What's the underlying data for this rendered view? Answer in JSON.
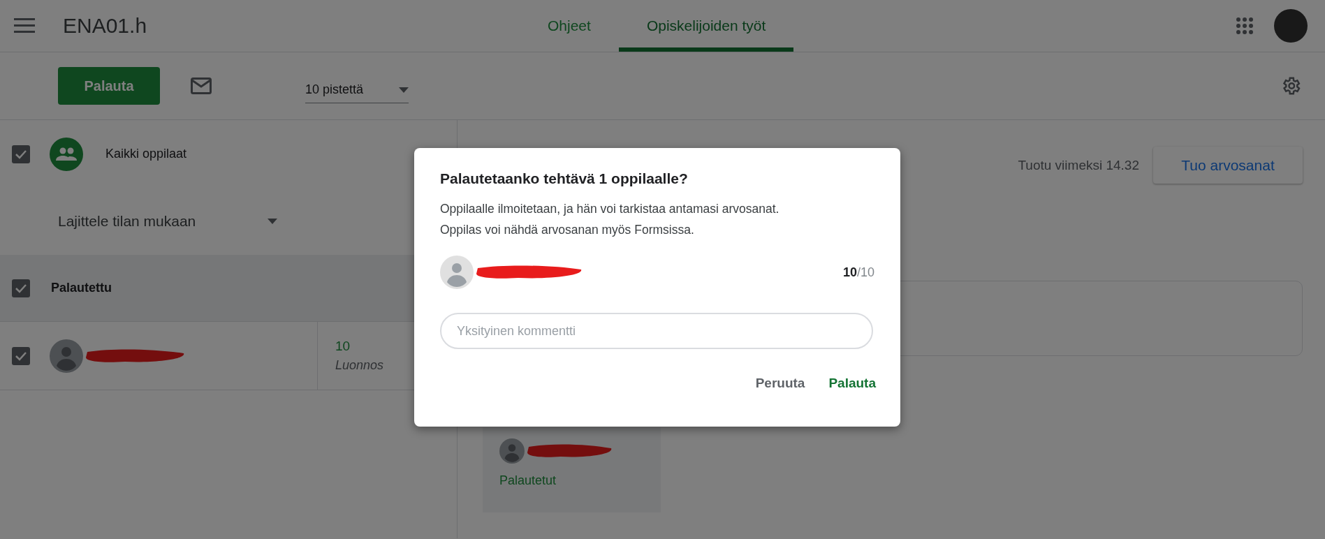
{
  "header": {
    "title": "ENA01.h",
    "tabs": [
      {
        "label": "Ohjeet",
        "selected": false
      },
      {
        "label": "Opiskelijoiden työt",
        "selected": true
      }
    ]
  },
  "toolbar": {
    "return_button": "Palauta",
    "points_dropdown": "10 pistettä"
  },
  "roster": {
    "all_students": {
      "label": "Kaikki oppilaat",
      "checked": true
    },
    "sort_dropdown": "Lajittele tilan mukaan",
    "groups": [
      {
        "label": "Palautettu",
        "checked": true,
        "students": [
          {
            "checked": true,
            "grade": "10",
            "status": "Luonnos"
          }
        ]
      }
    ]
  },
  "detail": {
    "last_imported": "Tuotu viimeksi 14.32",
    "import_button": "Tuo arvosanat",
    "card": {
      "status": "Palautetut"
    }
  },
  "dialog": {
    "title": "Palautetaanko tehtävä 1 oppilaalle?",
    "message": "Oppilaalle ilmoitetaan, ja hän voi tarkistaa antamasi arvosanat.\nOppilas voi nähdä arvosanan myös Formsissa.",
    "student": {
      "score": "**10**/10"
    },
    "comment": {
      "placeholder": "Yksityinen kommentti"
    },
    "buttons": [
      {
        "label": "Peruuta",
        "kind": "cancel"
      },
      {
        "label": "Palauta",
        "kind": "confirm"
      }
    ]
  }
}
